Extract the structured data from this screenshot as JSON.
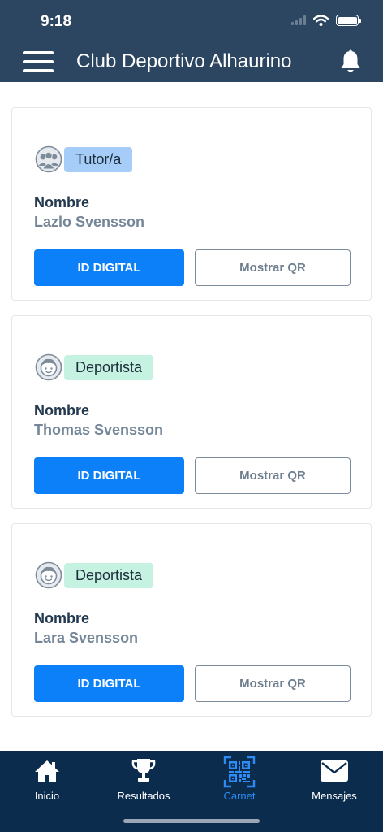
{
  "status_bar": {
    "time": "9:18"
  },
  "header": {
    "title": "Club Deportivo Alhaurino"
  },
  "colors": {
    "header_bg": "#2c4661",
    "tabbar_bg": "#0c2c4e",
    "primary": "#0b80f8",
    "active_tab": "#2d8cf5"
  },
  "cards": [
    {
      "role": "Tutor/a",
      "role_icon": "group-icon",
      "name_label": "Nombre",
      "name": "Lazlo Svensson",
      "id_button": "ID DIGITAL",
      "qr_button": "Mostrar QR"
    },
    {
      "role": "Deportista",
      "role_icon": "athlete-face-icon",
      "name_label": "Nombre",
      "name": "Thomas Svensson",
      "id_button": "ID DIGITAL",
      "qr_button": "Mostrar QR"
    },
    {
      "role": "Deportista",
      "role_icon": "athlete-face-icon",
      "name_label": "Nombre",
      "name": "Lara Svensson",
      "id_button": "ID DIGITAL",
      "qr_button": "Mostrar QR"
    }
  ],
  "tabbar": {
    "items": [
      {
        "label": "Inicio",
        "icon": "home-icon"
      },
      {
        "label": "Resultados",
        "icon": "trophy-icon"
      },
      {
        "label": "Carnet",
        "icon": "qr-code-icon",
        "active": true
      },
      {
        "label": "Mensajes",
        "icon": "mail-icon"
      }
    ]
  }
}
